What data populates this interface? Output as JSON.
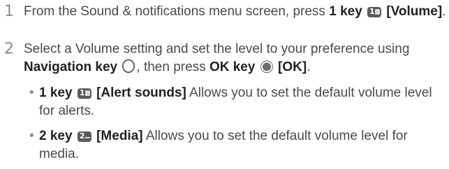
{
  "steps": [
    {
      "number": "1",
      "text_a": "From the Sound & notifications menu screen, press",
      "key_label": "1 key",
      "key_icon": "key-1-icon",
      "menu_label": "[Volume]",
      "end": "."
    },
    {
      "number": "2",
      "text_a": "Select a Volume setting and set the level to your preference using",
      "nav_label": "Navigation key",
      "nav_icon": "navigation-key-icon",
      "text_b": ", then press",
      "ok_label": "OK key",
      "ok_icon": "ok-key-icon",
      "ok_menu": "[OK]",
      "end": "."
    }
  ],
  "options": [
    {
      "key_label": "1 key",
      "key_icon": "key-1-icon",
      "menu_label": "[Alert sounds]",
      "description": "Allows you to set the default volume level for alerts."
    },
    {
      "key_label": "2 key",
      "key_icon": "key-2-icon",
      "menu_label": "[Media]",
      "description": "Allows you to set the default volume level for media."
    }
  ],
  "bullet_symbol": "•"
}
